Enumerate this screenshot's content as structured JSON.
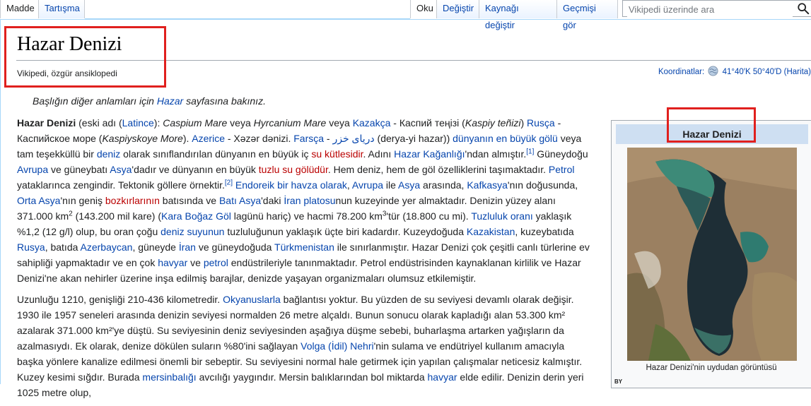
{
  "tabs_left": [
    "Madde",
    "Tartışma"
  ],
  "tabs_right": [
    "Oku",
    "Değiştir",
    "Kaynağı değiştir",
    "Geçmişi gör"
  ],
  "search": {
    "placeholder": "Vikipedi üzerinde ara"
  },
  "article": {
    "title": "Hazar Denizi",
    "tagline": "Vikipedi, özgür ansiklopedi",
    "coordinates_label": "Koordinatlar:",
    "coordinates_value": "41°40′K 50°40′D (Harita)",
    "hatnote_before": "Başlığın diğer anlamları için ",
    "hatnote_link": "Hazar",
    "hatnote_after": " sayfasına bakınız."
  },
  "paragraphs": [
    [
      [
        "b",
        "Hazar Denizi"
      ],
      [
        "t",
        " (eski adı "
      ],
      [
        "t",
        "("
      ],
      [
        "a",
        "Latince"
      ],
      [
        "t",
        "): "
      ],
      [
        "i",
        "Caspium Mare"
      ],
      [
        "t",
        " veya "
      ],
      [
        "i",
        "Hyrcanium Mare"
      ],
      [
        "t",
        " veya "
      ],
      [
        "a",
        "Kazakça"
      ],
      [
        "t",
        " - Каспий теңізі ("
      ],
      [
        "i",
        "Kaspiy teñizi"
      ],
      [
        "t",
        ") "
      ],
      [
        "a",
        "Rusça"
      ],
      [
        "t",
        " - Каспийское море ("
      ],
      [
        "i",
        "Kaspiyskoye More"
      ],
      [
        "t",
        "). "
      ],
      [
        "a",
        "Azerice"
      ],
      [
        "t",
        " - Xəzər dənizi. "
      ],
      [
        "a",
        "Farsça"
      ],
      [
        "t",
        " - "
      ],
      [
        "a",
        "دریای خزر"
      ],
      [
        "t",
        " (derya-yi hazar)) "
      ],
      [
        "a",
        "dünyanın en büyük gölü"
      ],
      [
        "t",
        " veya tam teşekküllü bir "
      ],
      [
        "a",
        "deniz"
      ],
      [
        "t",
        " olarak sınıflandırılan dünyanın en büyük iç "
      ],
      [
        "r",
        "su kütlesidir"
      ],
      [
        "t",
        ". Adını "
      ],
      [
        "a",
        "Hazar Kağanlığı"
      ],
      [
        "t",
        "'ndan almıştır."
      ],
      [
        "s",
        "[1]"
      ],
      [
        "t",
        " Güneydoğu "
      ],
      [
        "a",
        "Avrupa"
      ],
      [
        "t",
        " ve güneybatı "
      ],
      [
        "a",
        "Asya"
      ],
      [
        "t",
        "'dadır ve dünyanın en büyük "
      ],
      [
        "r",
        "tuzlu su gölüdür"
      ],
      [
        "t",
        ". Hem deniz, hem de göl özelliklerini taşımaktadır. "
      ],
      [
        "a",
        "Petrol"
      ],
      [
        "t",
        " yataklarınca zengindir. Tektonik göllere örnektir."
      ],
      [
        "s",
        "[2]"
      ],
      [
        "t",
        " "
      ],
      [
        "a",
        "Endoreik bir havza olarak"
      ],
      [
        "t",
        ", "
      ],
      [
        "a",
        "Avrupa"
      ],
      [
        "t",
        " ile "
      ],
      [
        "a",
        "Asya"
      ],
      [
        "t",
        " arasında, "
      ],
      [
        "a",
        "Kafkasya"
      ],
      [
        "t",
        "'nın doğusunda, "
      ],
      [
        "a",
        "Orta Asya"
      ],
      [
        "t",
        "'nın geniş "
      ],
      [
        "r",
        "bozkırlarının"
      ],
      [
        "t",
        " batısında ve "
      ],
      [
        "a",
        "Batı Asya"
      ],
      [
        "t",
        "'daki "
      ],
      [
        "a",
        "İran platosu"
      ],
      [
        "t",
        "nun kuzeyinde yer almaktadır. Denizin yüzey alanı 371.000 km"
      ],
      [
        "p",
        "2"
      ],
      [
        "t",
        " (143.200 mil kare) ("
      ],
      [
        "a",
        "Kara Boğaz Göl"
      ],
      [
        "t",
        " lagünü hariç) ve hacmi 78.200 km"
      ],
      [
        "p",
        "3"
      ],
      [
        "t",
        "'tür (18.800 cu mi). "
      ],
      [
        "a",
        "Tuzluluk oranı"
      ],
      [
        "t",
        " yaklaşık %1,2 (12 g/l) olup, bu oran çoğu "
      ],
      [
        "a",
        "deniz suyunun"
      ],
      [
        "t",
        " tuzluluğunun yaklaşık üçte biri kadardır. Kuzeydoğuda "
      ],
      [
        "a",
        "Kazakistan"
      ],
      [
        "t",
        ", kuzeybatıda "
      ],
      [
        "a",
        "Rusya"
      ],
      [
        "t",
        ", batıda "
      ],
      [
        "a",
        "Azerbaycan"
      ],
      [
        "t",
        ", güneyde "
      ],
      [
        "a",
        "İran"
      ],
      [
        "t",
        " ve güneydoğuda "
      ],
      [
        "a",
        "Türkmenistan"
      ],
      [
        "t",
        " ile sınırlanmıştır. Hazar Denizi çok çeşitli canlı türlerine ev sahipliği yapmaktadır ve en çok "
      ],
      [
        "a",
        "havyar"
      ],
      [
        "t",
        " ve "
      ],
      [
        "a",
        "petrol"
      ],
      [
        "t",
        " endüstrileriyle tanınmaktadır. Petrol endüstrisinden kaynaklanan kirlilik ve Hazar Denizi'ne akan nehirler üzerine inşa edilmiş barajlar, denizde yaşayan organizmaları olumsuz etkilemiştir."
      ]
    ],
    [
      [
        "t",
        "Uzunluğu 1210, genişliği 210-436 kilometredir. "
      ],
      [
        "a",
        "Okyanuslarla"
      ],
      [
        "t",
        " bağlantısı yoktur. Bu yüzden de su seviyesi devamlı olarak değişir. 1930 ile 1957 seneleri arasında denizin seviyesi normalden 26 metre alçaldı. Bunun sonucu olarak kapladığı alan 53.300 km² azalarak 371.000 km²'ye düştü. Su seviyesinin deniz seviyesinden aşağıya düşme sebebi, buharlaşma artarken yağışların da azalmasıydı. Ek olarak, denize dökülen suların %80'ini sağlayan "
      ],
      [
        "a",
        "Volga (İdil) Nehri"
      ],
      [
        "t",
        "'nin sulama ve endütriyel kullanım amacıyla başka yönlere kanalize edilmesi önemli bir sebeptir. Su seviyesini normal hale getirmek için yapılan çalışmalar neticesiz kalmıştır. Kuzey kesimi sığdır. Burada "
      ],
      [
        "a",
        "mersinbalığı"
      ],
      [
        "t",
        " avcılığı yaygındır. Mersin balıklarından bol miktarda "
      ],
      [
        "a",
        "havyar"
      ],
      [
        "t",
        " elde edilir. Denizin derin yeri 1025 metre olup,"
      ]
    ]
  ],
  "infobox": {
    "title": "Hazar Denizi",
    "caption": "Hazar Denizi'nin uydudan görüntüsü",
    "footer_text": "BY"
  },
  "colors": {
    "link": "#0645ad",
    "redlink": "#ba0000",
    "highlight": "#e0201e",
    "infobox_header": "#cedff2"
  }
}
